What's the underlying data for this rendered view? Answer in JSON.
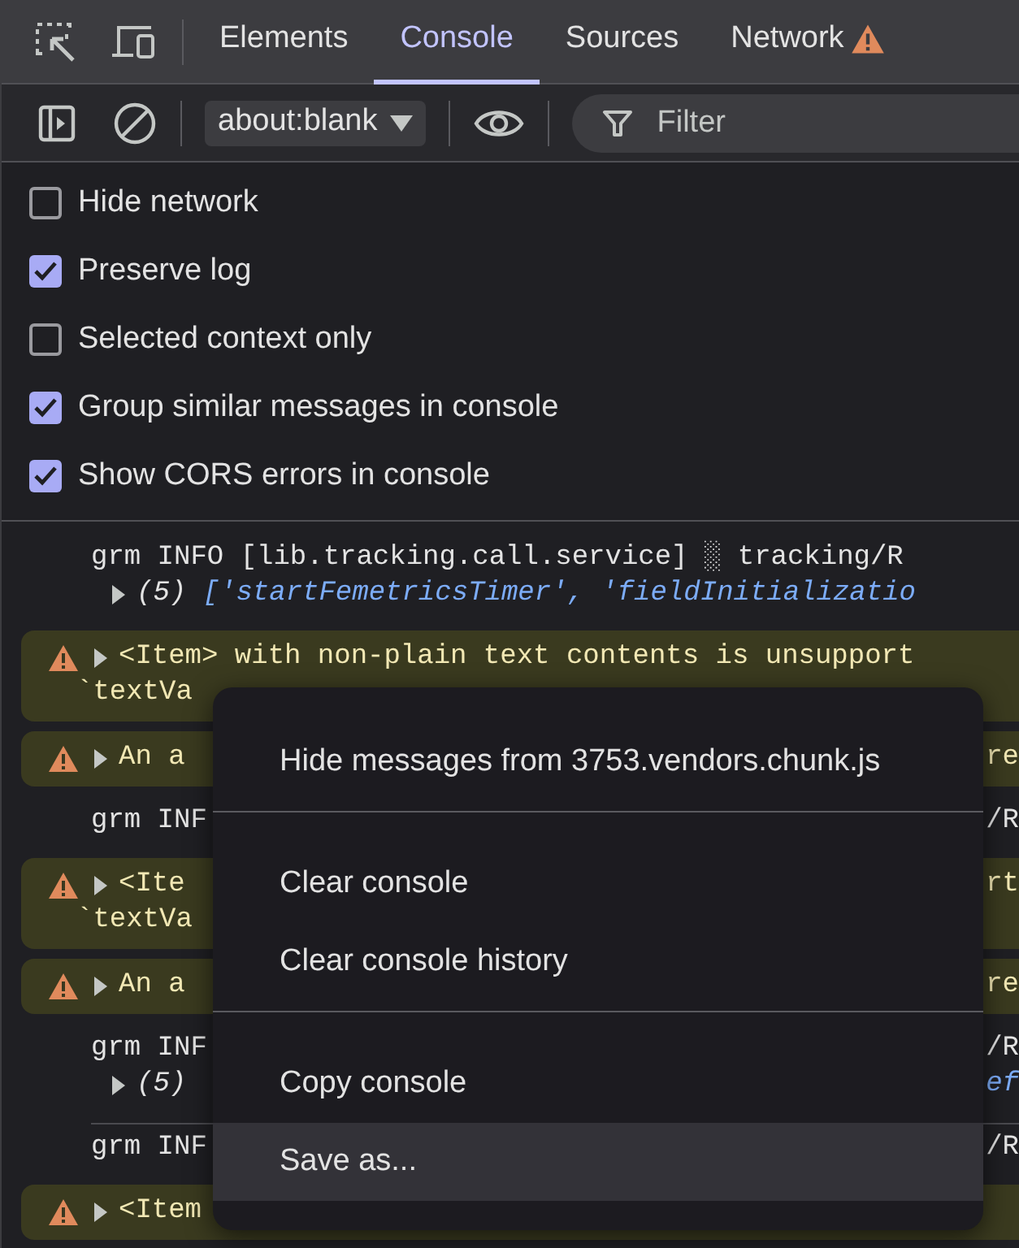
{
  "tabs": [
    {
      "label": "Elements",
      "selected": false,
      "warning": false
    },
    {
      "label": "Console",
      "selected": true,
      "warning": false
    },
    {
      "label": "Sources",
      "selected": false,
      "warning": false
    },
    {
      "label": "Network",
      "selected": false,
      "warning": true
    }
  ],
  "toolbar": {
    "context": "about:blank",
    "filter": {
      "placeholder": "Filter"
    }
  },
  "settings": [
    {
      "label": "Hide network",
      "checked": false
    },
    {
      "label": "Preserve log",
      "checked": true
    },
    {
      "label": "Selected context only",
      "checked": false
    },
    {
      "label": "Group similar messages in console",
      "checked": true
    },
    {
      "label": "Show CORS errors in console",
      "checked": true
    }
  ],
  "console_rows": [
    {
      "kind": "info",
      "lines": [
        {
          "expander": false,
          "left": [
            {
              "text": "grm INFO [lib.tracking.call.service] ░ tracking/R",
              "kind": "plain"
            }
          ]
        },
        {
          "expander": true,
          "left": [
            {
              "text": "(5) ",
              "kind": "count"
            },
            {
              "text": "['startFemetricsTimer', 'fieldInitializatio",
              "kind": "string"
            }
          ]
        }
      ]
    },
    {
      "kind": "warning",
      "lines": [
        {
          "expander": true,
          "left": [
            {
              "text": "<Item> with non-plain text contents is unsupport",
              "kind": "plain"
            }
          ]
        },
        {
          "expander": false,
          "left": [
            {
              "text": "`textVa",
              "kind": "plain"
            }
          ]
        }
      ]
    },
    {
      "kind": "warning",
      "lines": [
        {
          "expander": true,
          "left": [
            {
              "text": "An a",
              "kind": "plain"
            }
          ],
          "right": [
            {
              "text": "re",
              "kind": "plain"
            }
          ]
        }
      ]
    },
    {
      "kind": "info",
      "lines": [
        {
          "expander": false,
          "left": [
            {
              "text": "grm INF",
              "kind": "plain"
            }
          ],
          "right": [
            {
              "text": "/R",
              "kind": "plain"
            }
          ]
        }
      ]
    },
    {
      "kind": "warning",
      "lines": [
        {
          "expander": true,
          "left": [
            {
              "text": "<Ite",
              "kind": "plain"
            }
          ],
          "right": [
            {
              "text": "rt",
              "kind": "plain"
            }
          ]
        },
        {
          "expander": false,
          "left": [
            {
              "text": "`textVa",
              "kind": "plain"
            }
          ]
        }
      ]
    },
    {
      "kind": "warning",
      "lines": [
        {
          "expander": true,
          "left": [
            {
              "text": "An a",
              "kind": "plain"
            }
          ],
          "right": [
            {
              "text": "re",
              "kind": "plain"
            }
          ]
        }
      ]
    },
    {
      "kind": "info",
      "lines": [
        {
          "expander": false,
          "left": [
            {
              "text": "grm INF",
              "kind": "plain"
            }
          ],
          "right": [
            {
              "text": "/R",
              "kind": "plain"
            }
          ]
        },
        {
          "expander": true,
          "left": [
            {
              "text": "(5)",
              "kind": "count"
            }
          ],
          "right": [
            {
              "text": "ef",
              "kind": "string"
            }
          ]
        }
      ]
    },
    {
      "kind": "info",
      "lines": [
        {
          "expander": false,
          "left": [
            {
              "text": "grm INF",
              "kind": "plain"
            }
          ],
          "right": [
            {
              "text": "/R",
              "kind": "plain"
            }
          ]
        }
      ]
    },
    {
      "kind": "warning",
      "lines": [
        {
          "expander": true,
          "left": [
            {
              "text": "<Item",
              "kind": "plain"
            }
          ]
        }
      ]
    }
  ],
  "context_menu": {
    "groups": [
      [
        {
          "label": "Hide messages from 3753.vendors.chunk.js",
          "selected": false
        }
      ],
      [
        {
          "label": "Clear console",
          "selected": false
        },
        {
          "label": "Clear console history",
          "selected": false
        }
      ],
      [
        {
          "label": "Copy console",
          "selected": false
        },
        {
          "label": "Save as...",
          "selected": true
        }
      ]
    ]
  }
}
